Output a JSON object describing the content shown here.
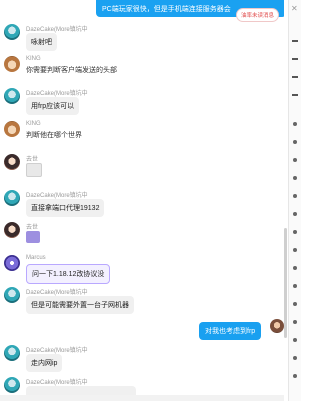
{
  "top_notice": {
    "text": "PC端玩家很快，但是手机端连接服务器会",
    "unread_label": "油率未读消息"
  },
  "messages": [
    {
      "avatar": "miku-avatar",
      "name": "DazeCake(More镇坑中",
      "text": "咏射吧"
    },
    {
      "avatar": "cat-avatar",
      "name": "KING",
      "text": "你需要判断客户端发送的头部"
    },
    {
      "avatar": "miku-avatar",
      "name": "DazeCake(More镇坑中",
      "text": "用frp应该可以"
    },
    {
      "avatar": "cat-avatar",
      "name": "KING",
      "text": "判断他在哪个世界"
    },
    {
      "avatar": "girl-avatar",
      "name": "去世",
      "text": ""
    },
    {
      "avatar": "miku-avatar",
      "name": "DazeCake(More镇坑中",
      "text": "直接拿端口代理19132"
    },
    {
      "avatar": "girl-avatar",
      "name": "去世",
      "text": ""
    },
    {
      "avatar": "marcus-avatar",
      "name": "Marcus",
      "text": "问一下1.18.12改协议没"
    },
    {
      "avatar": "miku-avatar",
      "name": "DazeCake(More镇坑中",
      "text": "但是可能需要外置一台子网机器"
    },
    {
      "avatar": "miku-avatar",
      "name": "DazeCake(More镇坑中",
      "text": "走内网ip"
    },
    {
      "avatar": "miku-avatar",
      "name": "DazeCake(More镇坑中",
      "text": ""
    }
  ],
  "self_message": {
    "text": "对我也考虑到frp"
  }
}
